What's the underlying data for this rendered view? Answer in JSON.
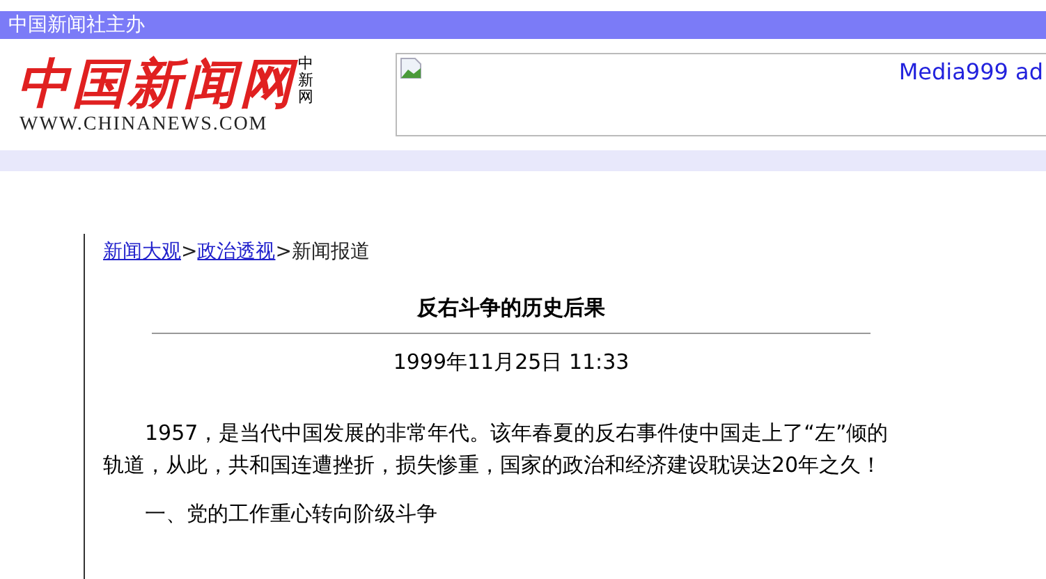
{
  "top_bar": {
    "text": "中国新闻社主办"
  },
  "logo": {
    "name": "中国新闻网",
    "short_name": "中新网",
    "url": "WWW.CHINANEWS.COM"
  },
  "ad": {
    "alt": "Media999 ad"
  },
  "breadcrumb": [
    {
      "label": "新闻大观",
      "link": true
    },
    {
      "label": ">",
      "link": false
    },
    {
      "label": "政治透视",
      "link": true
    },
    {
      "label": ">",
      "link": false
    },
    {
      "label": "新闻报道",
      "link": false
    }
  ],
  "article": {
    "title": "反右斗争的历史后果",
    "date": "1999年11月25日 11:33",
    "paragraphs": [
      "1957，是当代中国发展的非常年代。该年春夏的反右事件使中国走上了“左”倾的轨道，从此，共和国连遭挫折，损失惨重，国家的政治和经济建设耽误达20年之久！",
      "一、党的工作重心转向阶级斗争"
    ]
  }
}
